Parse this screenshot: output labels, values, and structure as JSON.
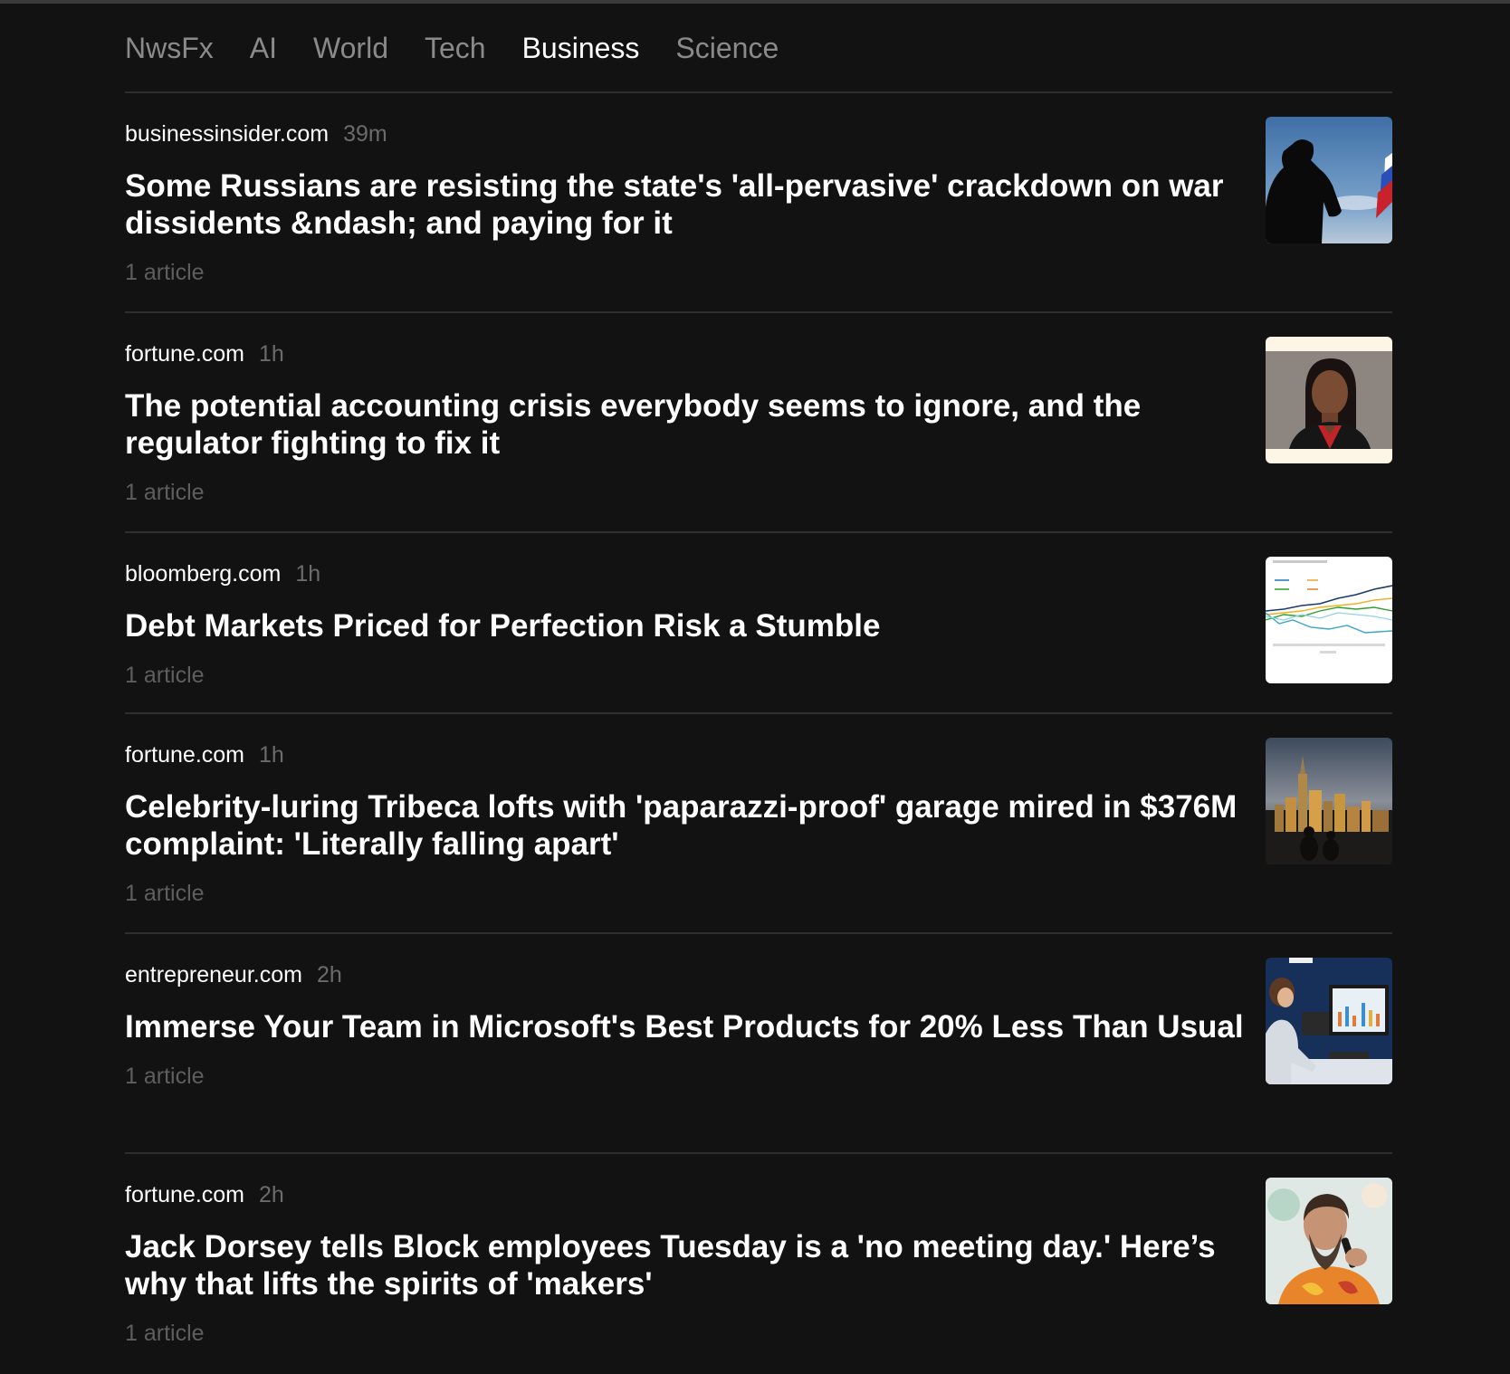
{
  "nav": {
    "items": [
      {
        "label": "NwsFx",
        "active": false
      },
      {
        "label": "AI",
        "active": false
      },
      {
        "label": "World",
        "active": false
      },
      {
        "label": "Tech",
        "active": false
      },
      {
        "label": "Business",
        "active": true
      },
      {
        "label": "Science",
        "active": false
      }
    ]
  },
  "stories": [
    {
      "source": "businessinsider.com",
      "time": "39m",
      "headline": "Some Russians are resisting the state's 'all-pervasive' crackdown on war dissidents &ndash; and paying for it",
      "count": "1 article",
      "thumb": "silhouette-flag-image"
    },
    {
      "source": "fortune.com",
      "time": "1h",
      "headline": "The potential accounting crisis everybody seems to ignore, and the regulator fighting to fix it",
      "count": "1 article",
      "thumb": "portrait-image"
    },
    {
      "source": "bloomberg.com",
      "time": "1h",
      "headline": "Debt Markets Priced for Perfection Risk a Stumble",
      "count": "1 article",
      "thumb": "line-chart-image"
    },
    {
      "source": "fortune.com",
      "time": "1h",
      "headline": "Celebrity-luring Tribeca lofts with 'paparazzi-proof' garage mired in $376M complaint: 'Literally falling apart'",
      "count": "1 article",
      "thumb": "city-skyline-image"
    },
    {
      "source": "entrepreneur.com",
      "time": "2h",
      "headline": "Immerse Your Team in Microsoft's Best Products for 20% Less Than Usual",
      "count": "1 article",
      "thumb": "office-worker-image"
    },
    {
      "source": "fortune.com",
      "time": "2h",
      "headline": "Jack Dorsey tells Block employees Tuesday is a 'no meeting day.' Here’s why that lifts the spirits of 'makers'",
      "count": "1 article",
      "thumb": "speaker-portrait-image"
    }
  ]
}
